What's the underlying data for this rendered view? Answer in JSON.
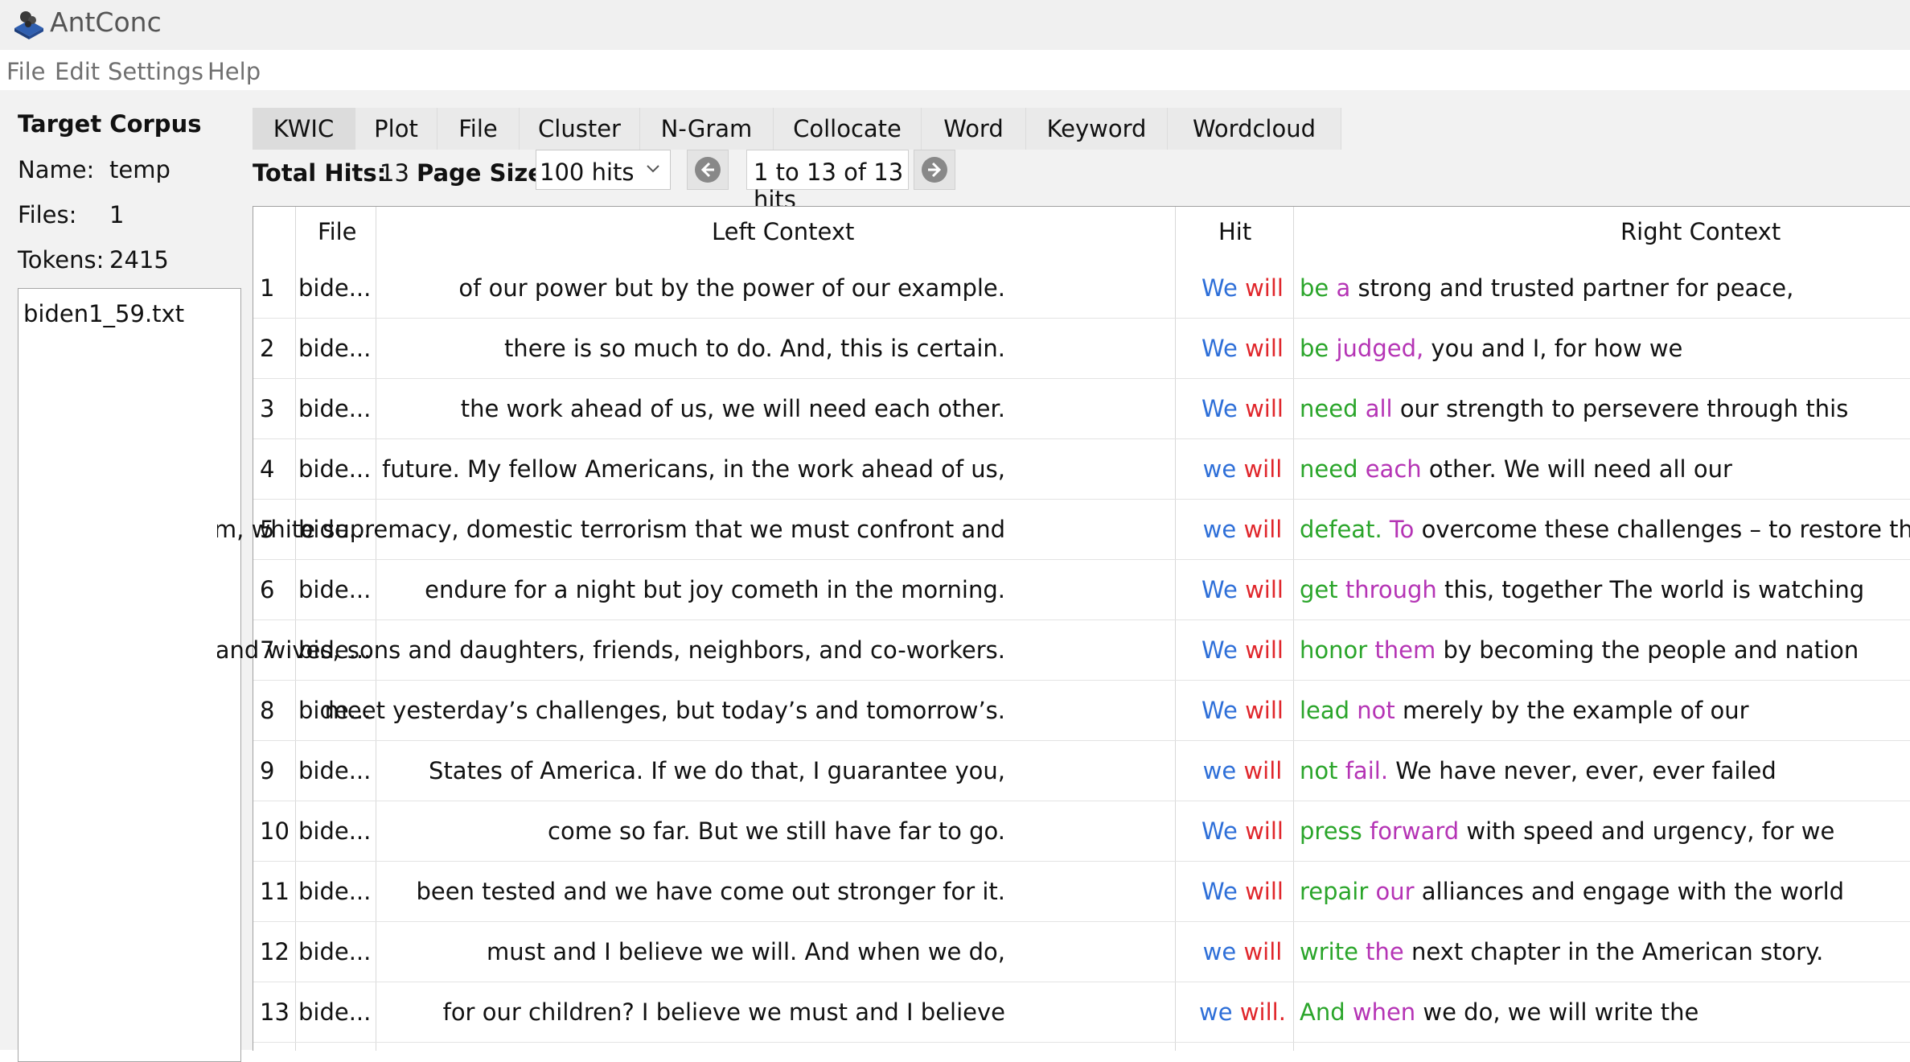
{
  "window": {
    "title": "AntConc"
  },
  "menu": [
    "File",
    "Edit",
    "Settings",
    "Help"
  ],
  "sidebar": {
    "heading": "Target Corpus",
    "name_label": "Name:",
    "name_value": "temp",
    "files_label": "Files:",
    "files_value": "1",
    "tokens_label": "Tokens:",
    "tokens_value": "2415",
    "file_list": [
      "biden1_59.txt"
    ]
  },
  "tabs": [
    "KWIC",
    "Plot",
    "File",
    "Cluster",
    "N-Gram",
    "Collocate",
    "Word",
    "Keyword",
    "Wordcloud"
  ],
  "active_tab": "KWIC",
  "controls": {
    "total_hits_label": "Total Hits:",
    "total_hits_value": "13",
    "page_size_label": "Page Size",
    "page_size_value": "100 hits",
    "hits_range": "1 to 13 of 13 hits"
  },
  "colors": {
    "hit_first": "#2e6fd8",
    "hit_second": "#e0262b",
    "rc_first": "#2aa52a",
    "rc_second": "#b534b5"
  },
  "table": {
    "headers": [
      "File",
      "Left Context",
      "Hit",
      "Right Context"
    ],
    "rows": [
      {
        "n": "1",
        "file": "bide...",
        "left": "of our power but by the power of our example.",
        "hit1": "We",
        "hit2": "will",
        "rc1": "be",
        "rc2": "a",
        "rc_rest": "strong and trusted partner for peace,"
      },
      {
        "n": "2",
        "file": "bide...",
        "left": "there is so much to do. And, this is certain.",
        "hit1": "We",
        "hit2": "will",
        "rc1": "be",
        "rc2": "judged,",
        "rc_rest": "you and I, for how we"
      },
      {
        "n": "3",
        "file": "bide...",
        "left": "the work ahead of us, we will need each other.",
        "hit1": "We",
        "hit2": "will",
        "rc1": "need",
        "rc2": "all",
        "rc_rest": "our strength to persevere through this"
      },
      {
        "n": "4",
        "file": "bide...",
        "left": "future. My fellow Americans, in the work ahead of us,",
        "hit1": "we",
        "hit2": "will",
        "rc1": "need",
        "rc2": "each",
        "rc_rest": "other. We will need all our"
      },
      {
        "n": "5",
        "file": "bide...",
        "left": "xtremism, white supremacy, domestic terrorism that we must confront and",
        "hit1": "we",
        "hit2": "will",
        "rc1": "defeat.",
        "rc2": "To",
        "rc_rest": "overcome these challenges – to restore the"
      },
      {
        "n": "6",
        "file": "bide...",
        "left": "endure for a night but joy cometh in the morning.",
        "hit1": "We",
        "hit2": "will",
        "rc1": "get",
        "rc2": "through",
        "rc_rest": "this, together The world is watching"
      },
      {
        "n": "7",
        "file": "bide...",
        "left": "and wives, sons and daughters, friends, neighbors, and co-workers.",
        "hit1": "We",
        "hit2": "will",
        "rc1": "honor",
        "rc2": "them",
        "rc_rest": "by becoming the people and nation"
      },
      {
        "n": "8",
        "file": "bide...",
        "left": "meet yesterday’s challenges, but today’s and tomorrow’s.",
        "hit1": "We",
        "hit2": "will",
        "rc1": "lead",
        "rc2": "not",
        "rc_rest": "merely by the example of our"
      },
      {
        "n": "9",
        "file": "bide...",
        "left": "States of America. If we do that, I guarantee you,",
        "hit1": "we",
        "hit2": "will",
        "rc1": "not",
        "rc2": "fail.",
        "rc_rest": "We have never, ever, ever failed"
      },
      {
        "n": "10",
        "file": "bide...",
        "left": "come so far. But we still have far to go.",
        "hit1": "We",
        "hit2": "will",
        "rc1": "press",
        "rc2": "forward",
        "rc_rest": "with speed and urgency, for we"
      },
      {
        "n": "11",
        "file": "bide...",
        "left": "been tested and we have come out stronger for it.",
        "hit1": "We",
        "hit2": "will",
        "rc1": "repair",
        "rc2": "our",
        "rc_rest": "alliances and engage with the world"
      },
      {
        "n": "12",
        "file": "bide...",
        "left": "must and I believe we will. And when we do,",
        "hit1": "we",
        "hit2": "will",
        "rc1": "write",
        "rc2": "the",
        "rc_rest": "next chapter in the American story."
      },
      {
        "n": "13",
        "file": "bide...",
        "left": "for our children? I believe we must and I believe",
        "hit1": "we",
        "hit2": "will.",
        "rc1": "And",
        "rc2": "when",
        "rc_rest": "we do, we will write the"
      }
    ]
  }
}
